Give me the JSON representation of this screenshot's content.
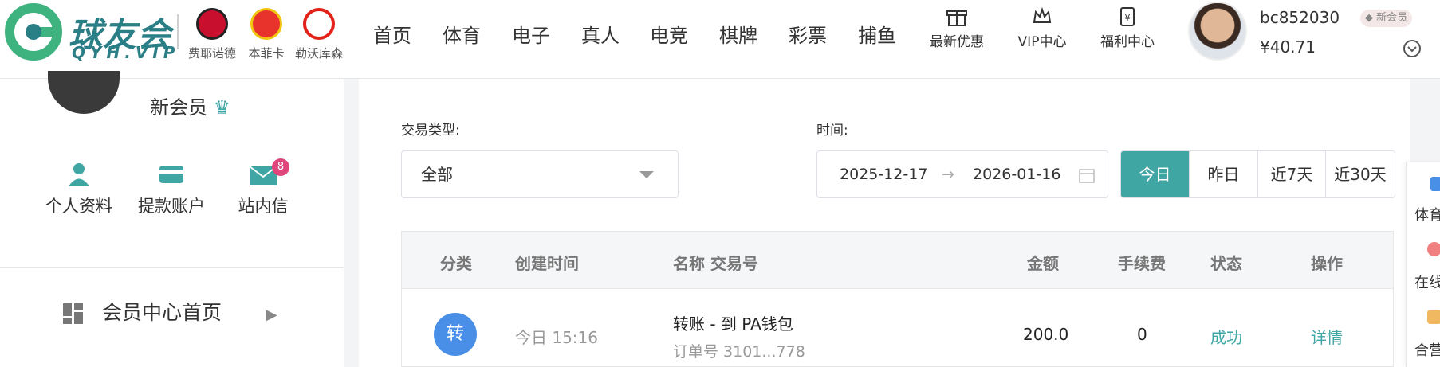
{
  "header": {
    "logo_text": "球友会",
    "logo_sub": "QYH.VIP",
    "partners": [
      {
        "name": "费耶诺德",
        "icon": "feyenoord-badge-icon",
        "color": "#c8102e"
      },
      {
        "name": "本菲卡",
        "icon": "benfica-badge-icon",
        "color": "#e8322c"
      },
      {
        "name": "勒沃库森",
        "icon": "leverkusen-badge-icon",
        "color": "#e32219"
      }
    ],
    "nav": [
      "首页",
      "体育",
      "电子",
      "真人",
      "电竞",
      "棋牌",
      "彩票",
      "捕鱼"
    ],
    "icon_nav": [
      {
        "label": "最新优惠",
        "icon": "gift-icon"
      },
      {
        "label": "VIP中心",
        "icon": "crown-icon"
      },
      {
        "label": "福利中心",
        "icon": "yen-box-icon"
      }
    ],
    "user": {
      "username": "bc852030",
      "balance": "¥40.71",
      "member_tag": "新会员"
    }
  },
  "sidebar": {
    "member_level": "新会员",
    "quick_links": [
      {
        "label": "个人资料",
        "icon": "user-icon"
      },
      {
        "label": "提款账户",
        "icon": "card-icon"
      },
      {
        "label": "站内信",
        "icon": "mail-icon",
        "badge": "8"
      }
    ],
    "menu_item": "会员中心首页"
  },
  "filters": {
    "type_label": "交易类型:",
    "type_value": "全部",
    "time_label": "时间:",
    "date_start": "2025-12-17",
    "date_end": "2026-01-16",
    "quick_ranges": [
      "今日",
      "昨日",
      "近7天",
      "近30天"
    ],
    "active_range": "今日"
  },
  "table": {
    "headers": [
      "分类",
      "创建时间",
      "名称 交易号",
      "金额",
      "手续费",
      "状态",
      "操作"
    ],
    "rows": [
      {
        "type_char": "转",
        "time": "今日 15:16",
        "name": "转账 - 到 PA钱包",
        "order": "订单号 3101...778",
        "amount": "200.0",
        "fee": "0",
        "status": "成功",
        "action": "详情"
      }
    ]
  },
  "right_rail": [
    "体育",
    "在线",
    "合营"
  ],
  "colors": {
    "accent": "#3fa6a4",
    "brand": "#2a7e86",
    "badge": "#e0457b",
    "type_circle": "#4a8fe7"
  }
}
